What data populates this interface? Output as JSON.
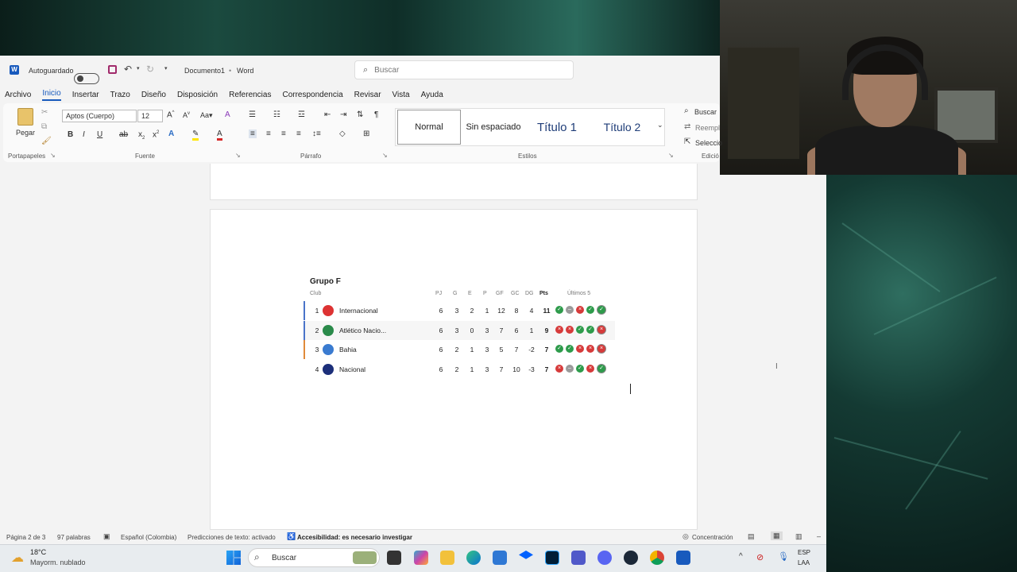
{
  "app": {
    "autosave_label": "Autoguardado",
    "document_title": "Documento1",
    "app_name": "Word",
    "search_placeholder": "Buscar"
  },
  "menu": {
    "tabs": [
      "Archivo",
      "Inicio",
      "Insertar",
      "Trazo",
      "Diseño",
      "Disposición",
      "Referencias",
      "Correspondencia",
      "Revisar",
      "Vista",
      "Ayuda"
    ],
    "active": "Inicio"
  },
  "ribbon": {
    "paste_label": "Pegar",
    "clipboard_label": "Portapapeles",
    "font_name": "Aptos (Cuerpo)",
    "font_size": "12",
    "font_label": "Fuente",
    "paragraph_label": "Párrafo",
    "styles_label": "Estilos",
    "editing_label": "Edició",
    "styles": [
      "Normal",
      "Sin espaciado",
      "Título 1",
      "Título 2"
    ],
    "find_label": "Buscar",
    "replace_label": "Reempl",
    "select_label": "Seleccio"
  },
  "standings": {
    "title": "Grupo F",
    "headers": {
      "club": "Club",
      "pj": "PJ",
      "g": "G",
      "e": "E",
      "p": "P",
      "gf": "GF",
      "gc": "GC",
      "dg": "DG",
      "pts": "Pts",
      "last5": "Últimos 5"
    },
    "rows": [
      {
        "pos": "1",
        "club": "Internacional",
        "pj": "6",
        "g": "3",
        "e": "2",
        "p": "1",
        "gf": "12",
        "gc": "8",
        "dg": "4",
        "pts": "11",
        "form": [
          "W",
          "D",
          "L",
          "W",
          "W"
        ],
        "bar": "#4a74c9",
        "crest": "#d33"
      },
      {
        "pos": "2",
        "club": "Atlético Nacio...",
        "pj": "6",
        "g": "3",
        "e": "0",
        "p": "3",
        "gf": "7",
        "gc": "6",
        "dg": "1",
        "pts": "9",
        "form": [
          "L",
          "L",
          "W",
          "W",
          "L"
        ],
        "bar": "#4a74c9",
        "crest": "#2a8a4a"
      },
      {
        "pos": "3",
        "club": "Bahia",
        "pj": "6",
        "g": "2",
        "e": "1",
        "p": "3",
        "gf": "5",
        "gc": "7",
        "dg": "-2",
        "pts": "7",
        "form": [
          "W",
          "W",
          "L",
          "L",
          "L"
        ],
        "bar": "#e08a3a",
        "crest": "#3a7bd0"
      },
      {
        "pos": "4",
        "club": "Nacional",
        "pj": "6",
        "g": "2",
        "e": "1",
        "p": "3",
        "gf": "7",
        "gc": "10",
        "dg": "-3",
        "pts": "7",
        "form": [
          "L",
          "D",
          "W",
          "L",
          "W"
        ],
        "bar": "",
        "crest": "#1c2f7a"
      }
    ]
  },
  "status": {
    "page": "Página 2 de 3",
    "words": "97 palabras",
    "language": "Español (Colombia)",
    "predictions": "Predicciones de texto: activado",
    "accessibility": "Accesibilidad: es necesario investigar",
    "focus": "Concentración"
  },
  "taskbar": {
    "temp": "18°C",
    "weather": "Mayorm. nublado",
    "search": "Buscar",
    "lang1": "ESP",
    "lang2": "LAA"
  },
  "colors": {
    "win": "#2e9b4b",
    "loss": "#d63a3a",
    "draw": "#9a9a9a",
    "accent": "#185abd"
  }
}
